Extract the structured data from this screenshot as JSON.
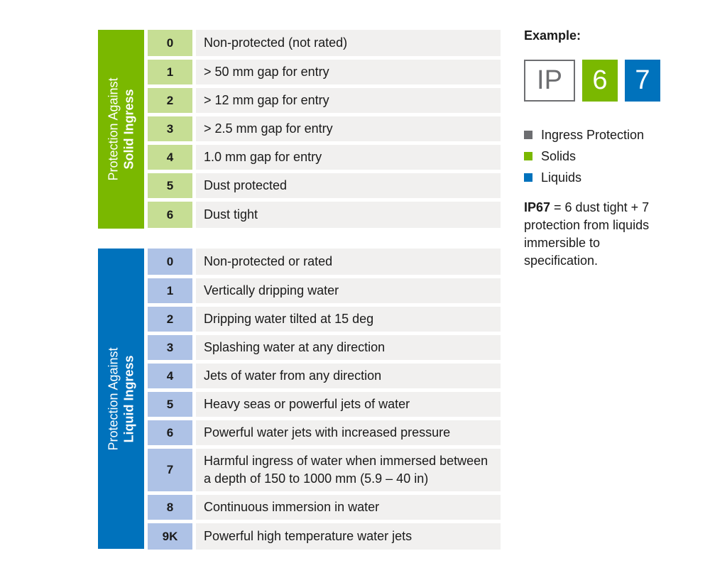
{
  "solid_section": {
    "label_light": "Protection Against",
    "label_bold": "Solid Ingress",
    "color": "#7ab800",
    "rows": [
      {
        "code": "0",
        "description": "Non-protected (not rated)"
      },
      {
        "code": "1",
        "description": "> 50 mm gap for entry"
      },
      {
        "code": "2",
        "description": "> 12 mm gap for entry"
      },
      {
        "code": "3",
        "description": "> 2.5 mm gap for entry"
      },
      {
        "code": "4",
        "description": "1.0 mm gap for entry"
      },
      {
        "code": "5",
        "description": "Dust protected"
      },
      {
        "code": "6",
        "description": "Dust tight"
      }
    ]
  },
  "liquid_section": {
    "label_light": "Protection Against",
    "label_bold": "Liquid Ingress",
    "color": "#0072bc",
    "rows": [
      {
        "code": "0",
        "description": "Non-protected or rated"
      },
      {
        "code": "1",
        "description": "Vertically dripping water"
      },
      {
        "code": "2",
        "description": "Dripping water tilted at 15 deg"
      },
      {
        "code": "3",
        "description": "Splashing water at any direction"
      },
      {
        "code": "4",
        "description": "Jets of water from any direction"
      },
      {
        "code": "5",
        "description": "Heavy seas or powerful jets of water"
      },
      {
        "code": "6",
        "description": "Powerful water jets with increased pressure"
      },
      {
        "code": "7",
        "description": "Harmful ingress of water when immersed between a depth of 150 to 1000 mm (5.9 – 40 in)"
      },
      {
        "code": "8",
        "description": "Continuous immersion in water"
      },
      {
        "code": "9K",
        "description": "Powerful high temperature water jets"
      }
    ]
  },
  "example": {
    "title": "Example:",
    "badges": {
      "ip": "IP",
      "solid": "6",
      "liquid": "7"
    },
    "legend": [
      {
        "label": "Ingress Protection",
        "color": "#6d6e71"
      },
      {
        "label": "Solids",
        "color": "#7ab800"
      },
      {
        "label": "Liquids",
        "color": "#0072bc"
      }
    ],
    "note_bold": "IP67",
    "note_text": " = 6 dust tight + 7 protection from liquids immersible to specification."
  }
}
